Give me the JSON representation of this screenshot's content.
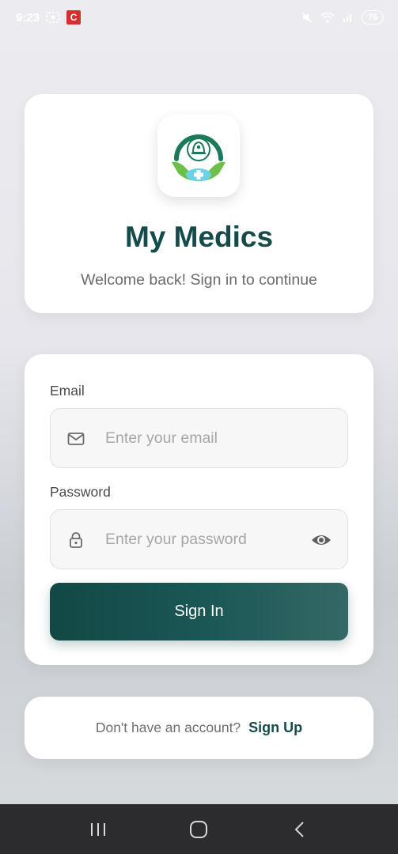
{
  "status_bar": {
    "time": "9:23",
    "app_badge": "C",
    "battery": "76"
  },
  "hero": {
    "title": "My Medics",
    "subtitle": "Welcome back! Sign in to continue"
  },
  "form": {
    "email": {
      "label": "Email",
      "placeholder": "Enter your email",
      "icon": "mail-icon"
    },
    "password": {
      "label": "Password",
      "placeholder": "Enter your password",
      "icon": "lock-icon",
      "toggle_icon": "eye-icon"
    },
    "submit_label": "Sign In"
  },
  "footer": {
    "prompt": "Don't have an account?",
    "link": "Sign Up"
  },
  "colors": {
    "brand": "#154b4a",
    "button_start": "#124846",
    "button_end": "#356866",
    "logo_green": "#4caf50",
    "logo_teal": "#1a7a5a",
    "logo_cyan": "#6ad3e8"
  },
  "nav": {
    "recents_icon": "recents-icon",
    "home_icon": "home-icon",
    "back_icon": "back-icon"
  }
}
